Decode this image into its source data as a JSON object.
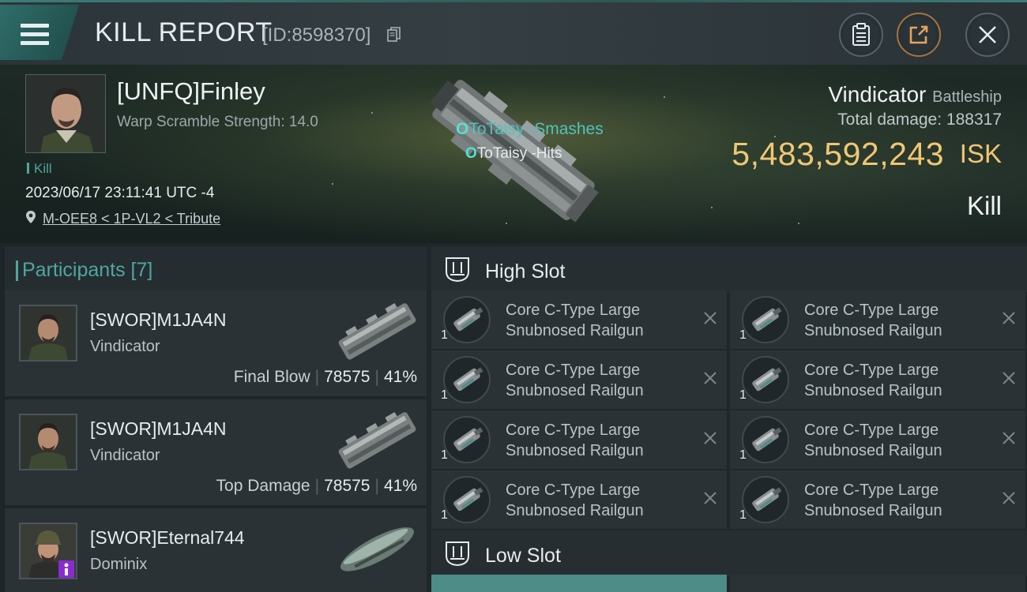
{
  "header": {
    "title": "KILL REPORT",
    "id_label": "[ID:8598370]",
    "buttons": [
      "clipboard-icon",
      "share-icon",
      "close-icon"
    ]
  },
  "victim": {
    "name": "[UNFQ]Finley",
    "warp_scramble": "Warp Scramble Strength: 14.0",
    "kill_tag": "Kill",
    "timestamp": "2023/06/17 23:11:41 UTC -4",
    "location": "M-OEE8 < 1P-VL2 < Tribute",
    "ship": "Vindicator",
    "ship_class": "Battleship",
    "total_damage_label": "Total damage:",
    "total_damage": "188317",
    "isk_value": "5,483,592,243",
    "isk_unit": "ISK",
    "result": "Kill"
  },
  "attack_tags": [
    {
      "prefix": "O",
      "text": "ToTaisy -Smashes"
    },
    {
      "prefix": "O",
      "text": "ToTaisy -Hits"
    }
  ],
  "participants": {
    "title": "Participants [7]",
    "rows": [
      {
        "name": "[SWOR]M1JA4N",
        "ship": "Vindicator",
        "label": "Final Blow",
        "damage": "78575",
        "percent": "41%"
      },
      {
        "name": "[SWOR]M1JA4N",
        "ship": "Vindicator",
        "label": "Top Damage",
        "damage": "78575",
        "percent": "41%"
      },
      {
        "name": "[SWOR]Eternal744",
        "ship": "Dominix",
        "label": "",
        "damage": "",
        "percent": ""
      }
    ]
  },
  "high_slot": {
    "title": "High Slot",
    "items": [
      {
        "name": "Core C-Type Large Snubnosed Railgun",
        "qty": "1"
      },
      {
        "name": "Core C-Type Large Snubnosed Railgun",
        "qty": "1"
      },
      {
        "name": "Core C-Type Large Snubnosed Railgun",
        "qty": "1"
      },
      {
        "name": "Core C-Type Large Snubnosed Railgun",
        "qty": "1"
      },
      {
        "name": "Core C-Type Large Snubnosed Railgun",
        "qty": "1"
      },
      {
        "name": "Core C-Type Large Snubnosed Railgun",
        "qty": "1"
      },
      {
        "name": "Core C-Type Large Snubnosed Railgun",
        "qty": "1"
      },
      {
        "name": "Core C-Type Large Snubnosed Railgun",
        "qty": "1"
      }
    ]
  },
  "low_slot": {
    "title": "Low Slot"
  },
  "colors": {
    "accent_teal": "#4fa6a0",
    "isk_gold": "#f0c772",
    "panel": "#2a3236"
  }
}
